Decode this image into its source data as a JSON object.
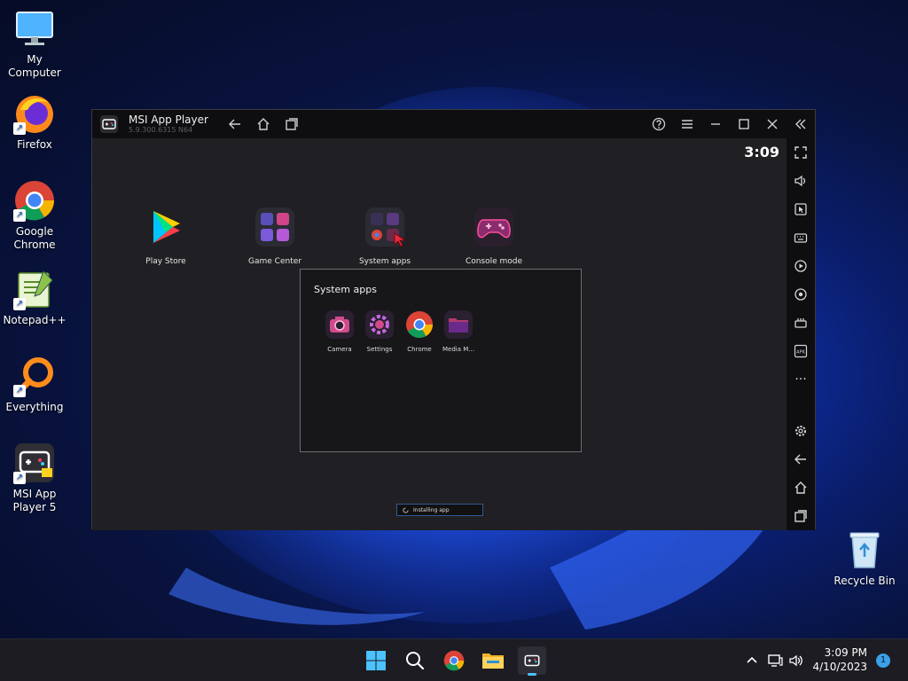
{
  "desktop": {
    "icons": [
      {
        "label": "My Computer"
      },
      {
        "label": "Firefox"
      },
      {
        "label": "Google Chrome"
      },
      {
        "label": "Notepad++"
      },
      {
        "label": "Everything"
      },
      {
        "label": "MSI App Player 5"
      },
      {
        "label": "Recycle Bin"
      }
    ]
  },
  "window": {
    "title": "MSI App Player",
    "version": "5.9.300.6315  N64",
    "clock": "3:09",
    "apps": [
      {
        "label": "Play Store"
      },
      {
        "label": "Game Center"
      },
      {
        "label": "System apps"
      },
      {
        "label": "Console mode"
      }
    ],
    "folder": {
      "title": "System apps",
      "apps": [
        {
          "label": "Camera"
        },
        {
          "label": "Settings"
        },
        {
          "label": "Chrome"
        },
        {
          "label": "Media M..."
        }
      ]
    },
    "toast": "Installing app",
    "sidebar_more": "···"
  },
  "taskbar": {
    "time": "3:09 PM",
    "date": "4/10/2023",
    "notification_count": "1"
  },
  "colors": {
    "accent": "#3aa0e8",
    "window_bg": "#202024",
    "titlebar_bg": "#0e0e10",
    "taskbar_bg": "#1c1c22"
  }
}
